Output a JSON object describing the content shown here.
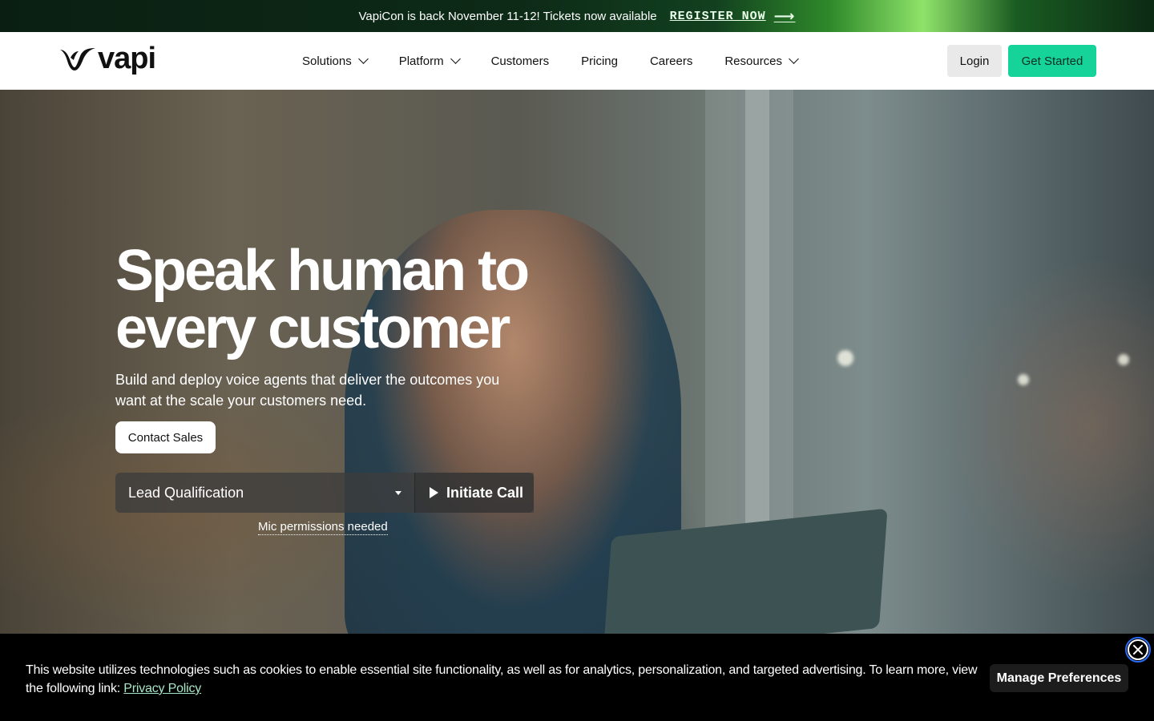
{
  "announcement": {
    "message": "VapiCon is back November 11-12! Tickets now available",
    "cta_label": "REGISTER NOW",
    "cta_arrow": "⟶"
  },
  "header": {
    "logo_text": "vapi",
    "nav": [
      {
        "label": "Solutions",
        "has_dropdown": true
      },
      {
        "label": "Platform",
        "has_dropdown": true
      },
      {
        "label": "Customers",
        "has_dropdown": false
      },
      {
        "label": "Pricing",
        "has_dropdown": false
      },
      {
        "label": "Careers",
        "has_dropdown": false
      },
      {
        "label": "Resources",
        "has_dropdown": true
      }
    ],
    "login_label": "Login",
    "get_started_label": "Get Started"
  },
  "hero": {
    "headline": "Speak human to every customer",
    "subtitle": "Build and deploy voice agents that deliver the outcomes you want at the scale your customers need.",
    "contact_label": "Contact Sales",
    "demo_select_value": "Lead Qualification",
    "initiate_label": "Initiate Call",
    "mic_note": "Mic permissions needed"
  },
  "cookie": {
    "text": "This website utilizes technologies such as cookies to enable essential site functionality, as well as for analytics, personalization, and targeted advertising. To learn more, view the following link:",
    "link_label": "Privacy Policy",
    "manage_label": "Manage Preferences"
  },
  "colors": {
    "accent_green": "#16d39a",
    "cookie_bg": "#000000",
    "link_green": "#a8e6c8"
  },
  "icons": [
    "vapi-logo-icon",
    "chevron-down-icon",
    "caret-down-icon",
    "play-icon",
    "close-icon",
    "arrow-right-icon"
  ]
}
